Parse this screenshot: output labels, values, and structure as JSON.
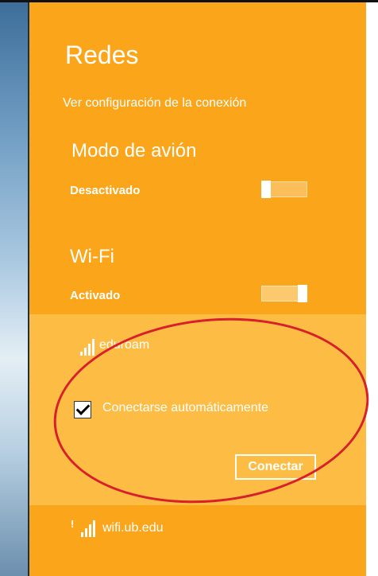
{
  "panel": {
    "title": "Redes",
    "connection_settings_link": "Ver configuración de la conexión"
  },
  "airplane_mode": {
    "heading": "Modo de avión",
    "state": "Desactivado",
    "enabled": false
  },
  "wifi": {
    "heading": "Wi-Fi",
    "state": "Activado",
    "enabled": true
  },
  "networks": [
    {
      "name": "eduroam",
      "icon": "wifi-signal-icon",
      "selected": true,
      "auto_connect_label": "Conectarse automáticamente",
      "auto_connect_checked": true,
      "connect_button": "Conectar"
    },
    {
      "name": "wifi.ub.edu",
      "icon": "wifi-signal-warning-icon",
      "selected": false
    }
  ],
  "colors": {
    "panel_bg": "#fba61a",
    "selected_bg": "#fdbd45",
    "annotation": "#d8202a",
    "text": "#ffffff"
  }
}
